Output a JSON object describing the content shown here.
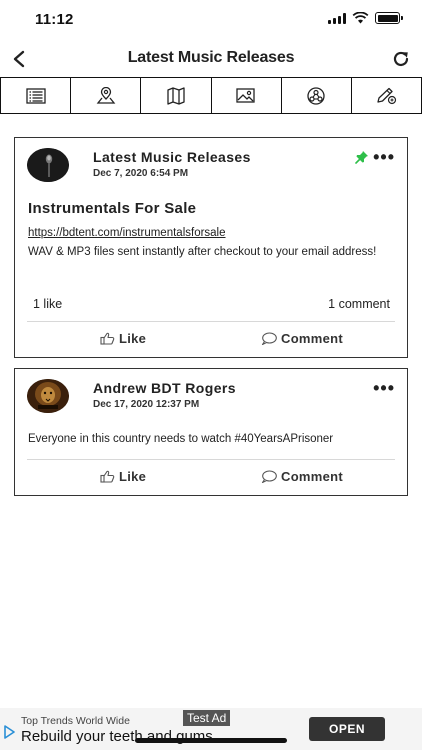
{
  "status_bar": {
    "time": "11:12"
  },
  "nav": {
    "title": "Latest Music Releases"
  },
  "tabs": [
    {
      "icon": "list-icon"
    },
    {
      "icon": "map-pin-icon"
    },
    {
      "icon": "map-icon"
    },
    {
      "icon": "image-icon"
    },
    {
      "icon": "network-icon"
    },
    {
      "icon": "edit-icon"
    }
  ],
  "posts": [
    {
      "author": "Latest Music Releases",
      "date": "Dec 7, 2020 6:54 PM",
      "pinned": true,
      "heading": "Instrumentals For Sale",
      "link": "https://bdtent.com/instrumentalsforsale",
      "body": "WAV & MP3 files sent instantly after checkout to your email address!",
      "likes": "1 like",
      "comments": "1 comment",
      "like_label": "Like",
      "comment_label": "Comment"
    },
    {
      "author": "Andrew BDT Rogers",
      "date": "Dec 17, 2020 12:37 PM",
      "body": "Everyone in this country needs to watch #40YearsAPrisoner",
      "like_label": "Like",
      "comment_label": "Comment"
    }
  ],
  "ad": {
    "source": "Top Trends World Wide",
    "headline": "Rebuild your teeth and gums",
    "label": "Test Ad",
    "cta": "OPEN"
  },
  "colors": {
    "pin": "#2fbf4a",
    "accent": "#111111"
  }
}
